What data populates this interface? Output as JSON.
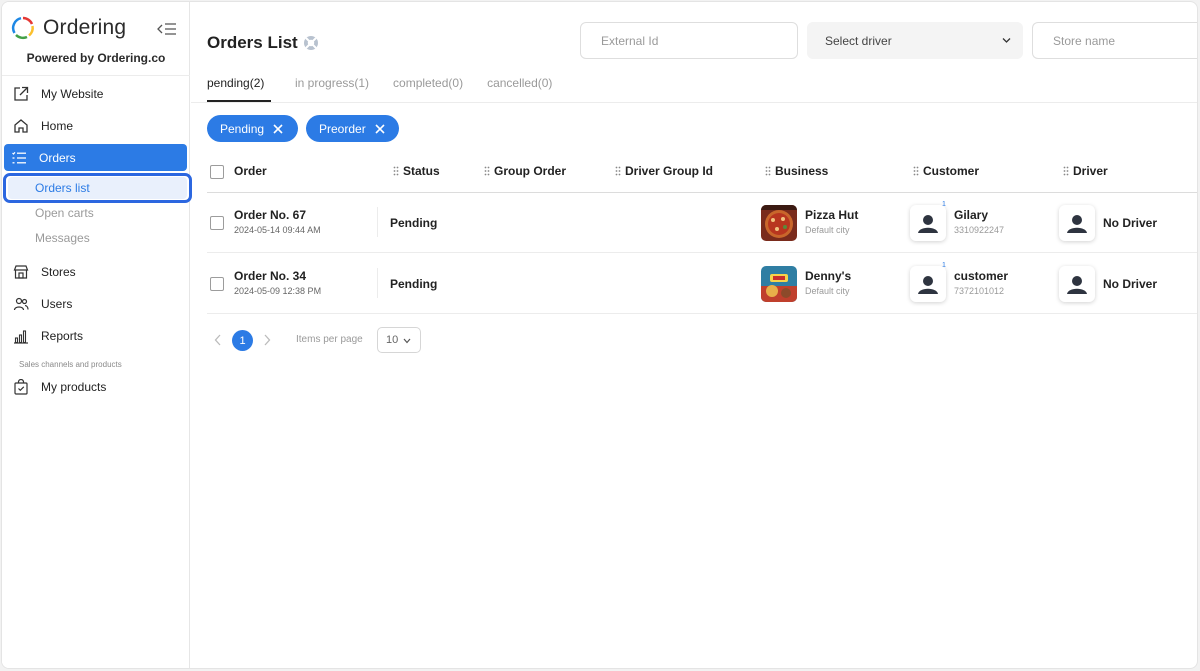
{
  "brand": {
    "name": "Ordering",
    "powered_by": "Powered by Ordering.co"
  },
  "sidebar": {
    "items": [
      {
        "label": "My Website",
        "icon": "external-link-icon"
      },
      {
        "label": "Home",
        "icon": "home-icon"
      },
      {
        "label": "Orders",
        "icon": "list-icon",
        "active": true
      },
      {
        "label": "Stores",
        "icon": "store-icon"
      },
      {
        "label": "Users",
        "icon": "users-icon"
      },
      {
        "label": "Reports",
        "icon": "bar-chart-icon"
      },
      {
        "label": "My products",
        "icon": "shopping-bag-icon"
      }
    ],
    "orders_sub": [
      "Orders list",
      "Open carts",
      "Messages"
    ],
    "section_label": "Sales channels and products"
  },
  "header": {
    "title": "Orders List",
    "external_id_placeholder": "External Id",
    "driver_select": "Select driver",
    "store_name_placeholder": "Store name"
  },
  "tabs": [
    "pending(2)",
    "in progress(1)",
    "completed(0)",
    "cancelled(0)"
  ],
  "chips": [
    "Pending",
    "Preorder"
  ],
  "table": {
    "columns": [
      "Order",
      "Status",
      "Group Order",
      "Driver Group Id",
      "Business",
      "Customer",
      "Driver"
    ],
    "rows": [
      {
        "order": "Order No. 67",
        "date": "2024-05-14 09:44 AM",
        "status": "Pending",
        "business": "Pizza Hut",
        "city": "Default city",
        "customer": "Gilary",
        "phone": "3310922247",
        "badge": "1",
        "driver": "No Driver"
      },
      {
        "order": "Order No. 34",
        "date": "2024-05-09 12:38 PM",
        "status": "Pending",
        "business": "Denny's",
        "city": "Default city",
        "customer": "customer",
        "phone": "7372101012",
        "badge": "1",
        "driver": "No Driver"
      }
    ]
  },
  "pagination": {
    "current": "1",
    "items_per_page_label": "Items per page",
    "items_per_page": "10"
  },
  "colors": {
    "accent": "#2c7be5",
    "highlight": "#2c67e0"
  }
}
